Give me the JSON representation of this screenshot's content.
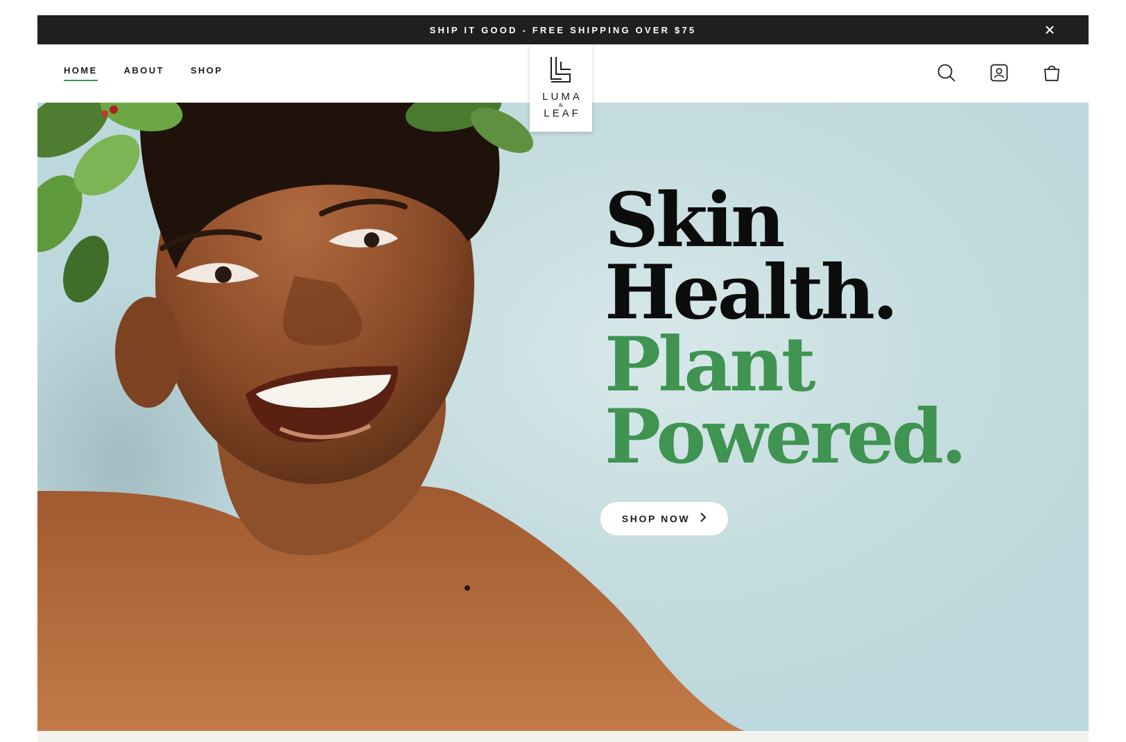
{
  "announcement": {
    "text": "SHIP IT GOOD - FREE SHIPPING OVER $75",
    "close_icon": "close-icon"
  },
  "nav": {
    "items": [
      {
        "label": "HOME",
        "active": true
      },
      {
        "label": "ABOUT",
        "active": false
      },
      {
        "label": "SHOP",
        "active": false
      }
    ]
  },
  "logo": {
    "line1": "LUMA",
    "amp": "&",
    "line2": "LEAF"
  },
  "header_icons": [
    "search-icon",
    "account-icon",
    "bag-icon"
  ],
  "hero": {
    "headline_line1": "Skin",
    "headline_line2": "Health.",
    "headline_line3": "Plant",
    "headline_line4": "Powered.",
    "cta_label": "SHOP NOW",
    "cta_icon": "chevron-right-icon"
  },
  "colors": {
    "accent_green": "#3e9450",
    "announcement_bg": "#1f1f1f",
    "hero_bg": "#c6dde0"
  }
}
